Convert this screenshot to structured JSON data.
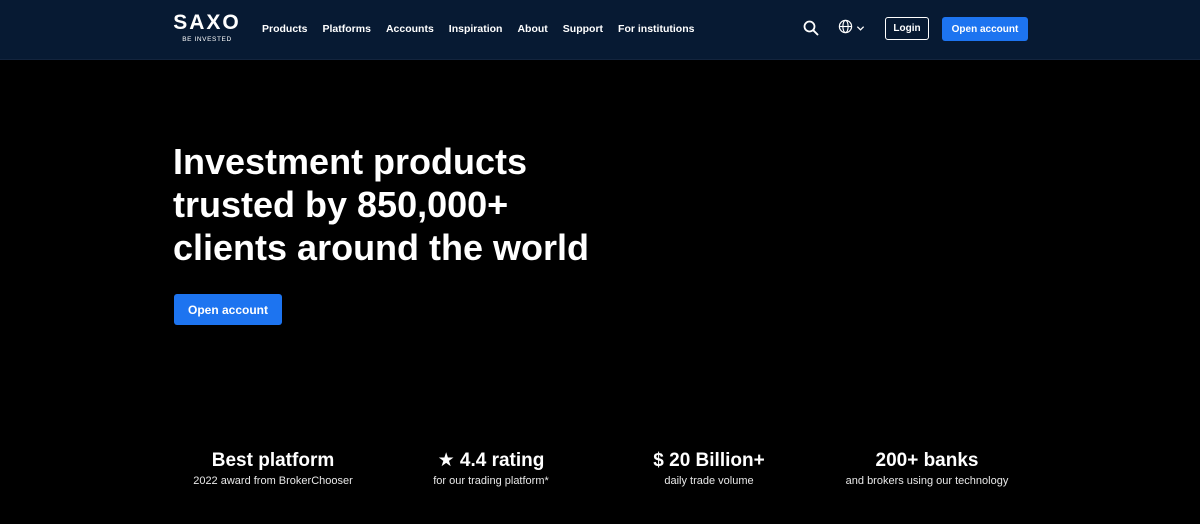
{
  "header": {
    "logo": {
      "word": "SAXO",
      "tagline": "BE INVESTED"
    },
    "nav": [
      "Products",
      "Platforms",
      "Accounts",
      "Inspiration",
      "About",
      "Support",
      "For institutions"
    ],
    "search_icon": "search-icon",
    "language_icon": "globe-icon",
    "login_label": "Login",
    "open_account_label": "Open account"
  },
  "hero": {
    "title_lines": [
      "Investment products",
      "trusted by 850,000+",
      "clients around the world"
    ],
    "cta_label": "Open account"
  },
  "stats": [
    {
      "headline": "Best platform",
      "subtext": "2022 award from BrokerChooser"
    },
    {
      "headline": "★ 4.4 rating",
      "subtext": "for our trading platform*"
    },
    {
      "headline": "$  20 Billion+",
      "subtext": "daily trade volume"
    },
    {
      "headline": "200+ banks",
      "subtext": "and brokers using our technology"
    }
  ],
  "colors": {
    "header_bg": "#071a33",
    "page_bg": "#000000",
    "accent": "#1d74f0",
    "text": "#ffffff"
  }
}
